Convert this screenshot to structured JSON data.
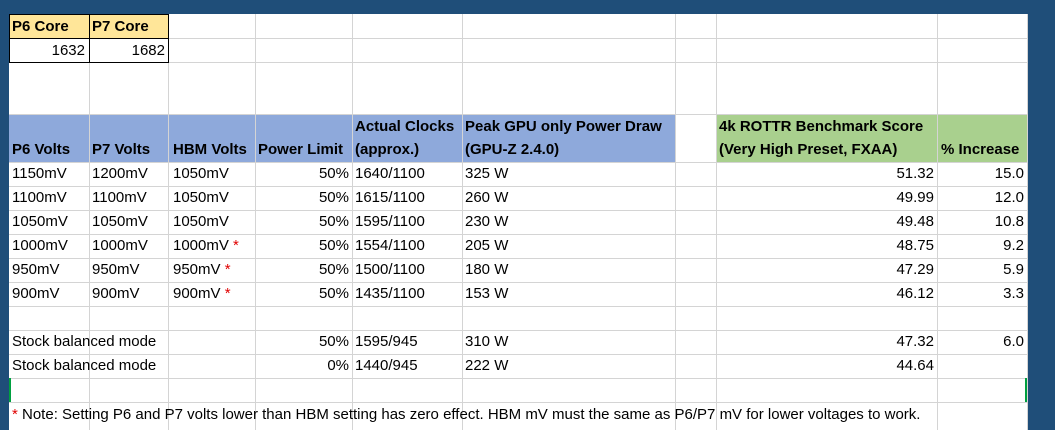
{
  "core_header": {
    "p6": "P6 Core",
    "p7": "P7 Core",
    "p6_value": "1632",
    "p7_value": "1682"
  },
  "headers": {
    "p6_volts": "P6 Volts",
    "p7_volts": "P7 Volts",
    "hbm_volts": "HBM Volts",
    "power_limit": "Power Limit",
    "clocks_1": "Actual Clocks",
    "clocks_2": "(approx.)",
    "power_draw_1": "Peak GPU only Power Draw",
    "power_draw_2": "(GPU-Z 2.4.0)",
    "score_1": "4k ROTTR Benchmark Score",
    "score_2": "(Very High Preset, FXAA)",
    "increase": "% Increase"
  },
  "rows": [
    {
      "p6": "1150mV",
      "p7": "1200mV",
      "hbm": "1050mV",
      "star": "",
      "power_limit": "50%",
      "clocks": "1640/1100",
      "power_draw": "325 W",
      "score": "51.32",
      "increase": "15.0"
    },
    {
      "p6": "1100mV",
      "p7": "1100mV",
      "hbm": "1050mV",
      "star": "",
      "power_limit": "50%",
      "clocks": "1615/1100",
      "power_draw": "260 W",
      "score": "49.99",
      "increase": "12.0"
    },
    {
      "p6": "1050mV",
      "p7": "1050mV",
      "hbm": "1050mV",
      "star": "",
      "power_limit": "50%",
      "clocks": "1595/1100",
      "power_draw": "230 W",
      "score": "49.48",
      "increase": "10.8"
    },
    {
      "p6": "1000mV",
      "p7": "1000mV",
      "hbm": "1000mV",
      "star": "*",
      "power_limit": "50%",
      "clocks": "1554/1100",
      "power_draw": "205 W",
      "score": "48.75",
      "increase": "9.2"
    },
    {
      "p6": "950mV",
      "p7": "950mV",
      "hbm": "950mV",
      "star": "*",
      "power_limit": "50%",
      "clocks": "1500/1100",
      "power_draw": "180 W",
      "score": "47.29",
      "increase": "5.9"
    },
    {
      "p6": "900mV",
      "p7": "900mV",
      "hbm": "900mV",
      "star": "*",
      "power_limit": "50%",
      "clocks": "1435/1100",
      "power_draw": "153 W",
      "score": "46.12",
      "increase": "3.3"
    }
  ],
  "stock_rows": [
    {
      "label": "Stock balanced mode",
      "power_limit": "50%",
      "clocks": "1595/945",
      "power_draw": "310 W",
      "score": "47.32",
      "increase": "6.0"
    },
    {
      "label": "Stock balanced mode",
      "power_limit": "0%",
      "clocks": "1440/945",
      "power_draw": "222 W",
      "score": "44.64",
      "increase": ""
    }
  ],
  "note": {
    "star": "*",
    "text": " Note: Setting P6 and P7 volts lower than HBM setting has zero effect.  HBM mV must the same as P6/P7 mV for lower voltages to work."
  },
  "colors": {
    "core_header_fill": "#ffe699",
    "blue_header_fill": "#8ea9db",
    "green_header_fill": "#a9d08e",
    "star": "#e00000",
    "frame": "#1f4e79"
  }
}
